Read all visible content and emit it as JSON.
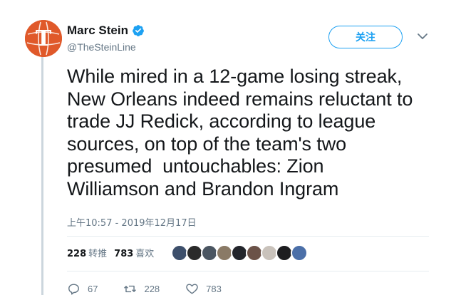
{
  "author": {
    "name": "Marc Stein",
    "handle": "@TheSteinLine",
    "verified": true
  },
  "follow_button": {
    "label": "关注"
  },
  "tweet": {
    "lines": [
      "While mired in a 12-game losing streak,",
      "New Orleans indeed remains reluctant to",
      "trade JJ Redick, according to league",
      "sources, on top of the team's two",
      "presumed  untouchables: Zion",
      "Williamson and Brandon Ingram"
    ],
    "timestamp": "上午10:57 - 2019年12月17日"
  },
  "stats": {
    "retweets_count": "228",
    "retweets_label": "转推",
    "likes_count": "783",
    "likes_label": "喜欢"
  },
  "likers": [
    "#3d4f6b",
    "#2a2a2a",
    "#4a5561",
    "#8a7a66",
    "#22252b",
    "#6b5248",
    "#c9c2bb",
    "#1d1d1f",
    "#4b6fa8"
  ],
  "actions": {
    "reply_count": "67",
    "retweet_count": "228",
    "like_count": "783"
  },
  "colors": {
    "accent": "#1da1f2",
    "avatar_bg": "#e0592a",
    "muted": "#657786"
  }
}
